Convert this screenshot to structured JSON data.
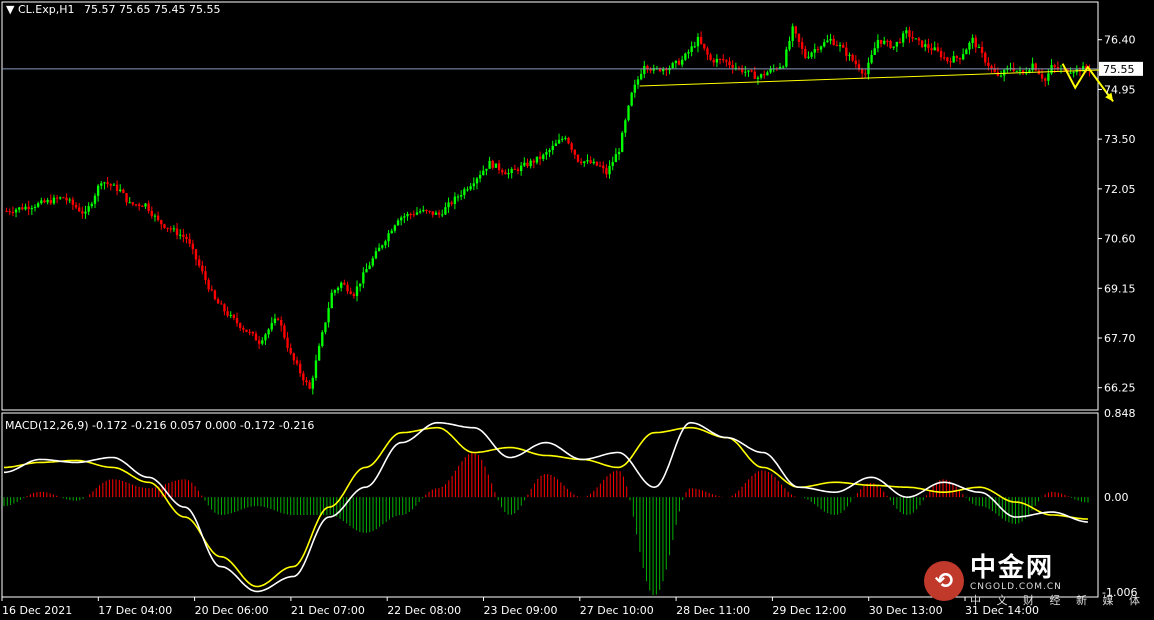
{
  "header": {
    "symbol": "CL.Exp,H1",
    "ohlc": "75.57 75.65 75.45 75.55"
  },
  "macd_header": {
    "text": "MACD(12,26,9) -0.172 -0.216 0.057 0.000 -0.172 -0.216"
  },
  "chart_data": [
    {
      "type": "candlestick",
      "symbol": "CL.Exp",
      "timeframe": "H1",
      "ylim": [
        65.6,
        77.5
      ],
      "y_ticks": [
        "76.40",
        "74.95",
        "73.50",
        "72.05",
        "70.60",
        "69.15",
        "67.70",
        "66.25"
      ],
      "y_tick_values": [
        76.4,
        74.95,
        73.5,
        72.05,
        70.6,
        69.15,
        67.7,
        66.25
      ],
      "current_price": 75.55,
      "current_price_label": "75.55",
      "x_tick_labels": [
        "16 Dec 2021",
        "17 Dec 04:00",
        "20 Dec 06:00",
        "21 Dec 07:00",
        "22 Dec 08:00",
        "23 Dec 09:00",
        "27 Dec 10:00",
        "28 Dec 11:00",
        "29 Dec 12:00",
        "30 Dec 13:00",
        "31 Dec 14:00"
      ],
      "price_path": {
        "x": [
          0,
          10,
          18,
          25,
          30,
          36,
          39,
          44,
          48,
          57,
          66,
          71,
          80,
          86,
          90,
          96,
          103,
          106,
          110,
          114,
          124,
          131,
          137,
          147,
          153,
          159,
          170,
          177,
          181,
          185,
          188,
          190,
          194,
          198,
          202,
          205,
          209,
          210,
          214,
          219,
          223,
          227,
          231,
          238,
          246,
          249,
          253,
          257,
          261,
          264,
          268,
          272,
          276,
          281,
          285,
          289,
          294,
          298,
          302,
          306,
          310,
          314,
          318,
          322,
          325,
          329,
          331,
          335,
          341,
          343
        ],
        "close": [
          71.4,
          71.6,
          71.8,
          71.3,
          72.3,
          72.0,
          71.6,
          71.6,
          71.1,
          70.6,
          68.8,
          68.3,
          67.6,
          68.3,
          67.2,
          66.2,
          69.0,
          69.3,
          69.0,
          69.7,
          71.2,
          71.4,
          71.3,
          72.2,
          72.8,
          72.5,
          73.0,
          73.6,
          72.9,
          72.8,
          72.7,
          72.5,
          73.2,
          74.8,
          75.7,
          75.5,
          75.6,
          75.6,
          75.8,
          76.4,
          75.8,
          75.8,
          75.6,
          75.3,
          75.7,
          76.7,
          75.9,
          76.2,
          76.4,
          76.2,
          75.8,
          75.4,
          76.4,
          76.2,
          76.6,
          76.3,
          76.1,
          75.8,
          75.9,
          76.4,
          75.8,
          75.3,
          75.6,
          75.4,
          75.7,
          75.2,
          75.6,
          75.5,
          75.55,
          75.55
        ],
        "note": ""
      },
      "trendline": {
        "from": {
          "x": 201,
          "y": 75.05
        },
        "to": {
          "x": 357,
          "y": 75.55
        }
      },
      "projection_arrows": [
        {
          "x": [
            335,
            339,
            343,
            351
          ],
          "y": [
            75.7,
            75.0,
            75.6,
            74.6
          ]
        }
      ]
    },
    {
      "type": "macd",
      "title": "MACD(12,26,9)",
      "values_label": "-0.172 -0.216 0.057 0.000 -0.172 -0.216",
      "ylim": [
        -1.006,
        0.848
      ],
      "y_ticks": [
        "0.848",
        "0.00"
      ],
      "y_tick_values": [
        0.848,
        0.0
      ],
      "bottom_label": "-1.006",
      "macd": [
        0.25,
        0.38,
        0.35,
        0.4,
        0.2,
        -0.1,
        -0.7,
        -0.95,
        -0.8,
        -0.2,
        0.1,
        0.55,
        0.75,
        0.7,
        0.4,
        0.55,
        0.38,
        0.45,
        0.1,
        0.75,
        0.6,
        0.45,
        0.1,
        0.05,
        0.2,
        0.0,
        0.15,
        0.05,
        -0.2,
        -0.15,
        -0.25
      ],
      "signal": [
        0.3,
        0.35,
        0.37,
        0.3,
        0.15,
        -0.2,
        -0.6,
        -0.9,
        -0.7,
        -0.1,
        0.3,
        0.65,
        0.7,
        0.45,
        0.5,
        0.42,
        0.38,
        0.3,
        0.65,
        0.7,
        0.6,
        0.3,
        0.1,
        0.15,
        0.12,
        0.1,
        0.05,
        0.1,
        -0.05,
        -0.18,
        -0.22
      ],
      "colors": {
        "macd_line": "#ffffff",
        "signal_line": "#ffff00",
        "hist_pos": "#ff0000",
        "hist_neg": "#00b000"
      }
    }
  ],
  "colors": {
    "background": "#000000",
    "bull": "#00ff00",
    "bear": "#ff0000",
    "grid_frame": "#ffffff",
    "price_line": "#8899bb",
    "trendline": "#ffff00",
    "arrow": "#ffff00"
  },
  "watermark": {
    "logo_glyph": "⟲",
    "name": "中金网",
    "domain": "CNGOLD.COM.CN",
    "tagline": "中 文 财 经 新 媒 体"
  }
}
